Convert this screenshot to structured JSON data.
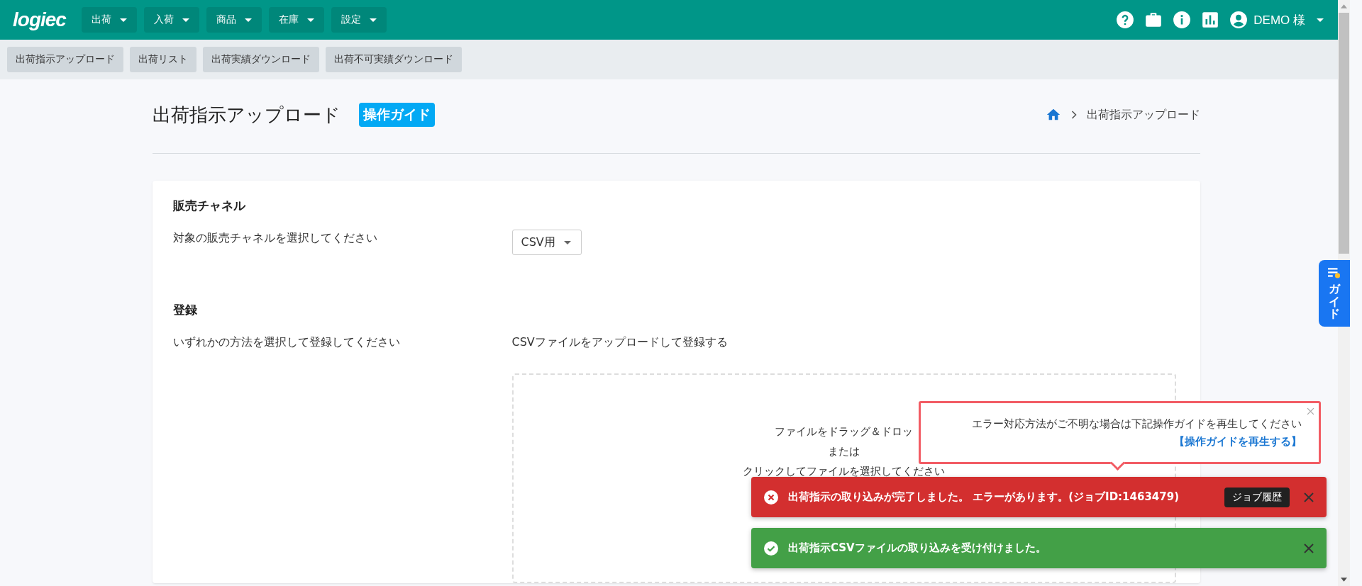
{
  "header": {
    "logo": "logiec",
    "menus": [
      {
        "label": "出荷"
      },
      {
        "label": "入荷"
      },
      {
        "label": "商品"
      },
      {
        "label": "在庫"
      },
      {
        "label": "設定"
      }
    ],
    "user": "DEMO 様"
  },
  "subnav": [
    {
      "label": "出荷指示アップロード"
    },
    {
      "label": "出荷リスト"
    },
    {
      "label": "出荷実績ダウンロード"
    },
    {
      "label": "出荷不可実績ダウンロード"
    }
  ],
  "page": {
    "title": "出荷指示アップロード",
    "guide_badge": "操作ガイド",
    "breadcrumb": [
      "出荷指示アップロード"
    ]
  },
  "sections": [
    {
      "heading": "販売チャネル",
      "label": "対象の販売チャネルを選択してください",
      "kind": "select",
      "value": "CSV用"
    },
    {
      "heading": "登録",
      "label": "いずれかの方法を選択して登録してください",
      "kind": "upload",
      "caption": "CSVファイルをアップロードして登録する",
      "drop_lines": [
        "ファイルをドラッグ＆ドロッ",
        "または",
        "クリックしてファイルを選択してください"
      ]
    }
  ],
  "side_tab": {
    "label": "ガイド"
  },
  "tooltip": {
    "message": "エラー対応方法がご不明な場合は下記操作ガイドを再生してください",
    "link": "【操作ガイドを再生する】"
  },
  "toasts": [
    {
      "kind": "error",
      "message": "出荷指示の取り込みが完了しました。 エラーがあります。(ジョブID:1463479)",
      "action": "ジョブ履歴"
    },
    {
      "kind": "success",
      "message": "出荷指示CSVファイルの取り込みを受け付けました。"
    }
  ]
}
